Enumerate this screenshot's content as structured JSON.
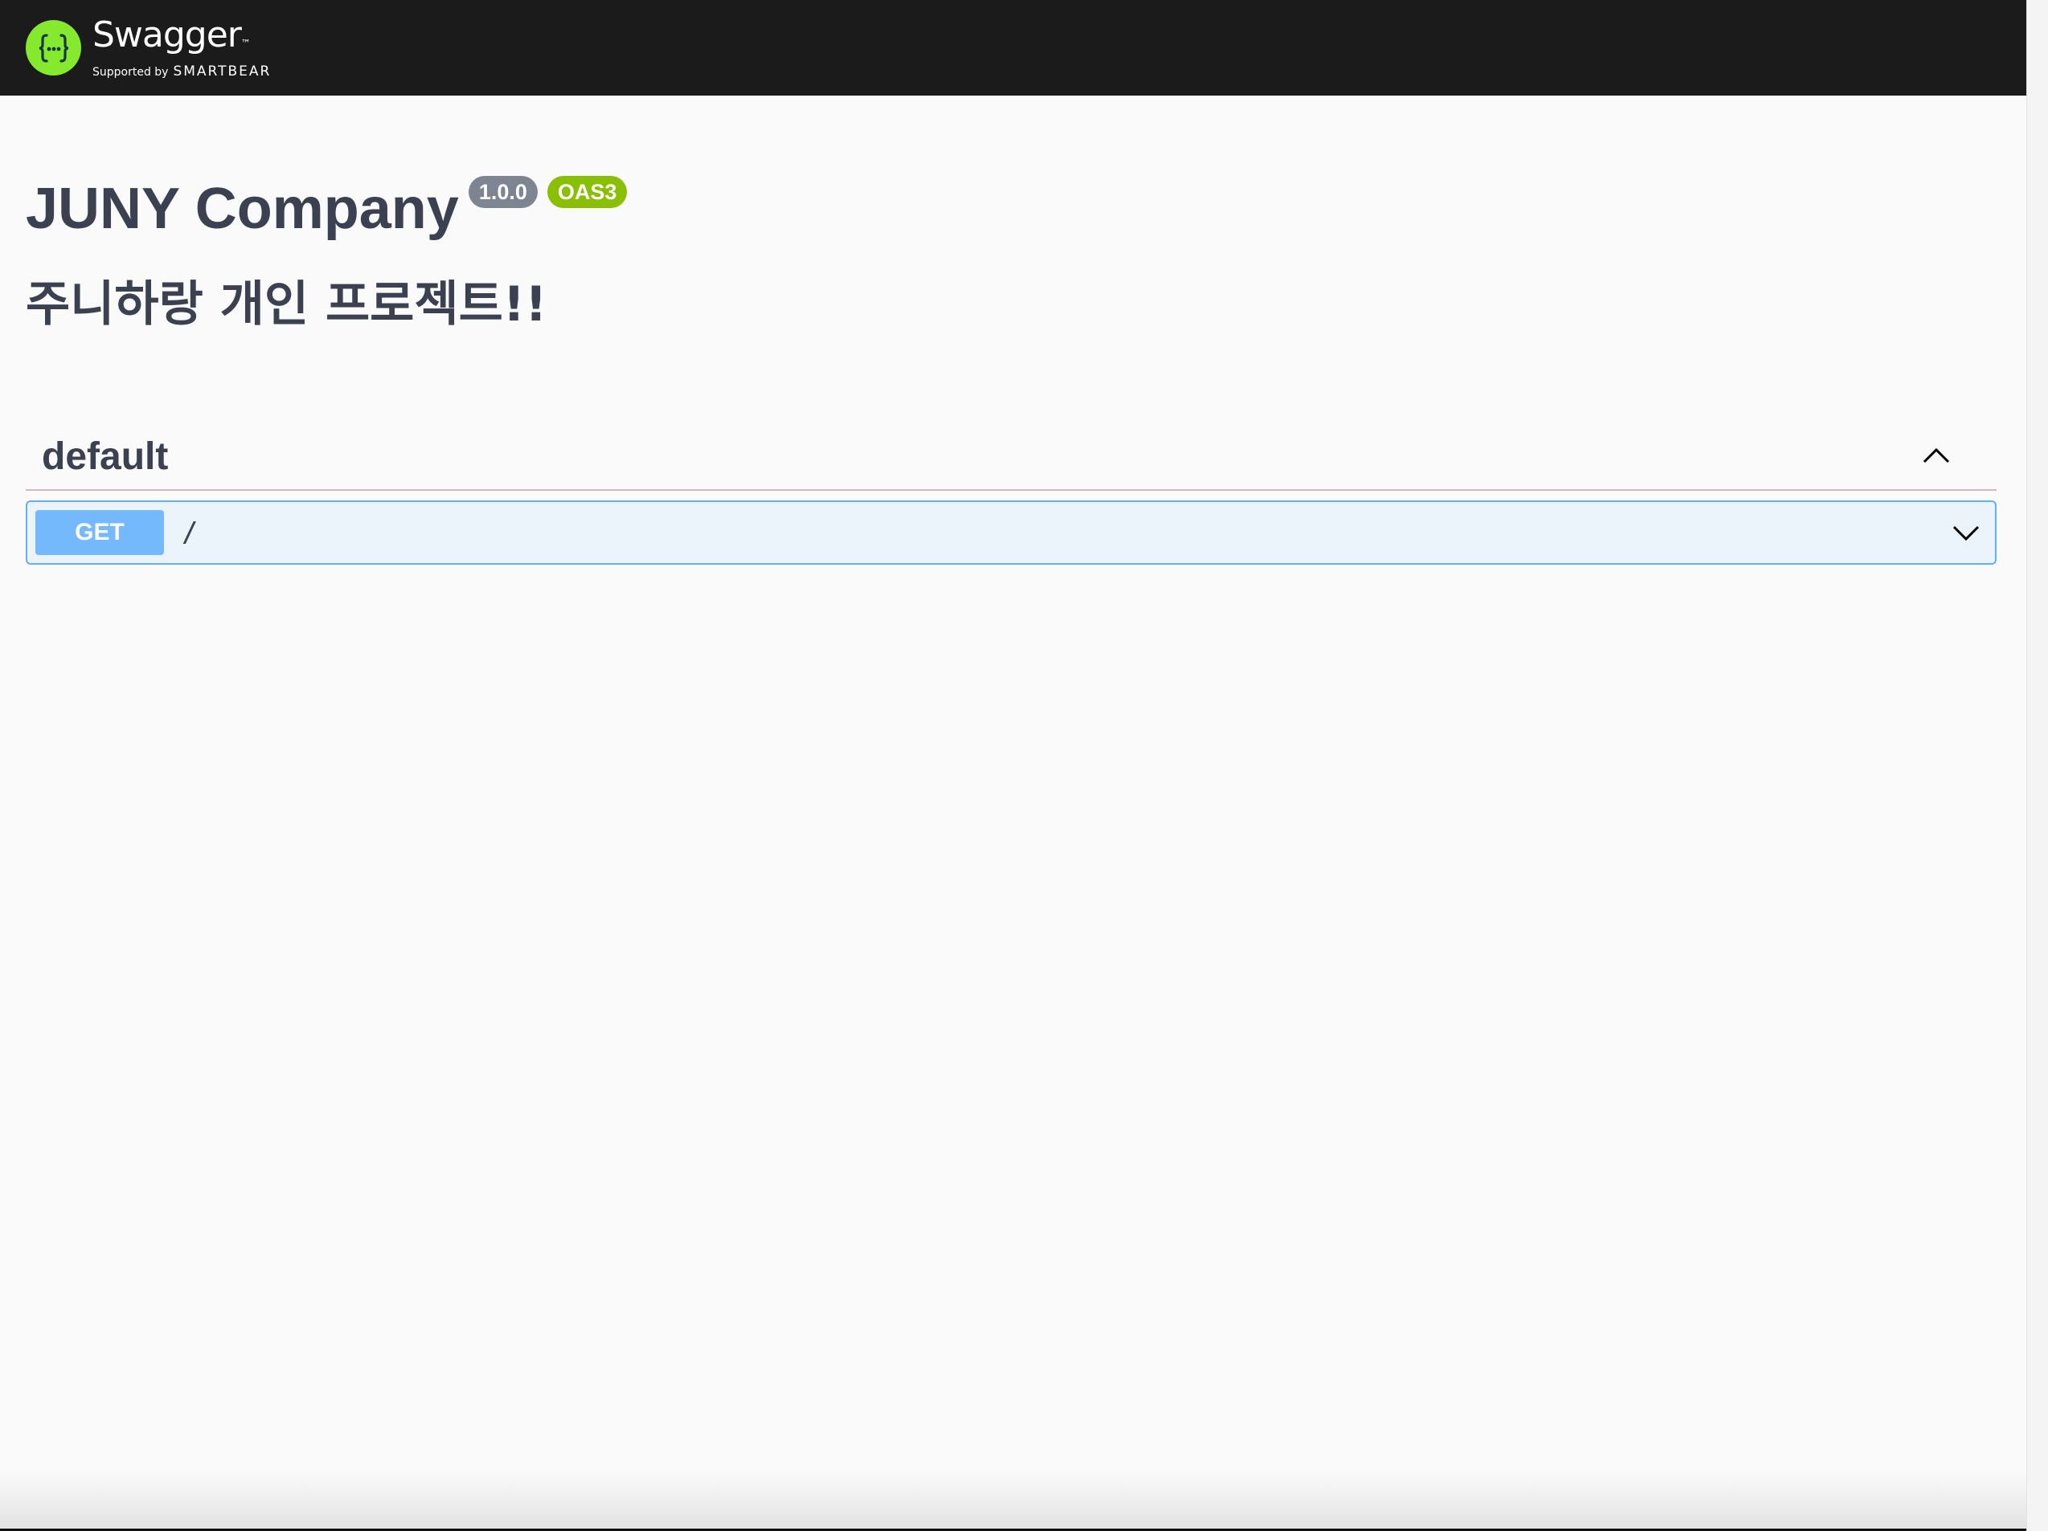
{
  "topbar": {
    "logo_word": "Swagger",
    "logo_tm": "™",
    "supported_by": "Supported by",
    "brand": "SMARTBEAR",
    "colors": {
      "background": "#1b1b1b",
      "logo": "#85ea2d"
    }
  },
  "info": {
    "title": "JUNY Company",
    "version_badge": "1.0.0",
    "oas_badge": "OAS3",
    "description": "주니하랑 개인 프로젝트!!"
  },
  "tags": [
    {
      "name": "default",
      "expanded": true,
      "toggle_icon": "chevron-up-icon",
      "operations": [
        {
          "method": "GET",
          "path": "/",
          "toggle_icon": "chevron-down-icon",
          "color": "#61affe"
        }
      ]
    }
  ]
}
